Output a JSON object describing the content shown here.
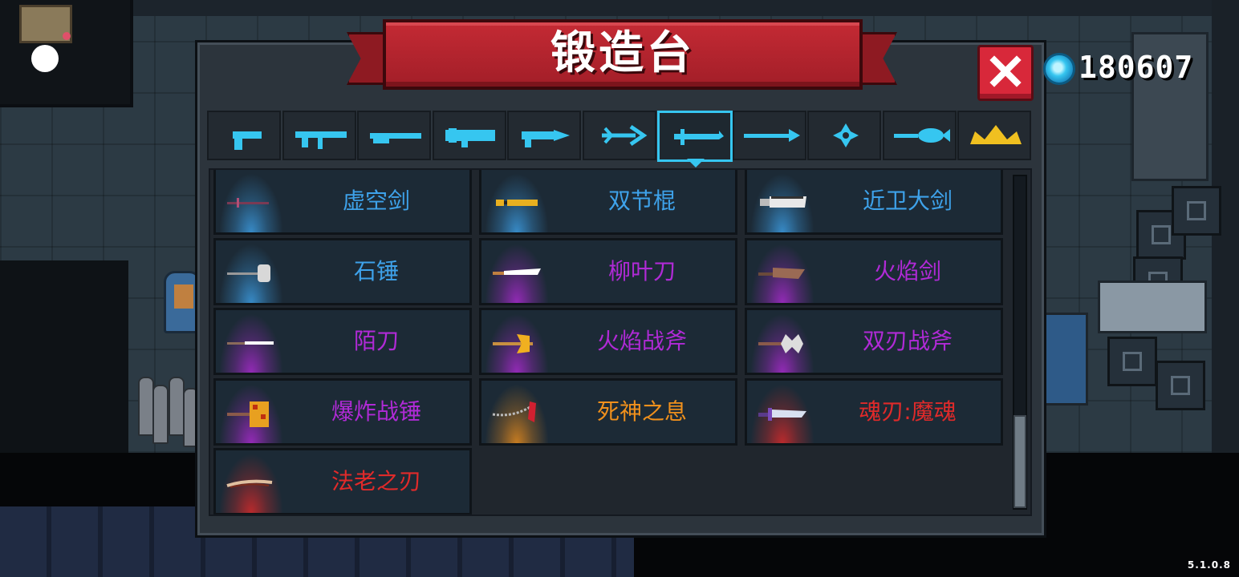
{
  "title": "锻造台",
  "gem_count": "180607",
  "version": "5.1.0.8",
  "colors": {
    "blue": "#3ea2ea",
    "purple": "#b02ad6",
    "orange": "#f0901c",
    "red": "#e02a2a",
    "accent": "#36c6f0"
  },
  "tabs": [
    {
      "icon": "pistol-icon",
      "selected": false
    },
    {
      "icon": "rifle-icon",
      "selected": false
    },
    {
      "icon": "shotgun-icon",
      "selected": false
    },
    {
      "icon": "launcher-icon",
      "selected": false
    },
    {
      "icon": "laser-gun-icon",
      "selected": false
    },
    {
      "icon": "bow-icon",
      "selected": false
    },
    {
      "icon": "sword-icon",
      "selected": true
    },
    {
      "icon": "spear-icon",
      "selected": false
    },
    {
      "icon": "shuriken-icon",
      "selected": false
    },
    {
      "icon": "fish-staff-icon",
      "selected": false
    },
    {
      "icon": "crown-icon",
      "selected": false
    }
  ],
  "weapons": [
    {
      "name": "虚空剑",
      "rarity": "blue",
      "icon": "void-sword-icon"
    },
    {
      "name": "双节棍",
      "rarity": "blue",
      "icon": "nunchaku-icon"
    },
    {
      "name": "近卫大剑",
      "rarity": "blue",
      "icon": "guard-greatsword-icon"
    },
    {
      "name": "石锤",
      "rarity": "blue",
      "icon": "stone-hammer-icon"
    },
    {
      "name": "柳叶刀",
      "rarity": "purple",
      "icon": "willow-blade-icon"
    },
    {
      "name": "火焰剑",
      "rarity": "purple",
      "icon": "flame-sword-icon"
    },
    {
      "name": "陌刀",
      "rarity": "purple",
      "icon": "mo-dao-icon"
    },
    {
      "name": "火焰战斧",
      "rarity": "purple",
      "icon": "flame-axe-icon"
    },
    {
      "name": "双刃战斧",
      "rarity": "purple",
      "icon": "double-axe-icon"
    },
    {
      "name": "爆炸战锤",
      "rarity": "purple",
      "icon": "explosive-hammer-icon"
    },
    {
      "name": "死神之息",
      "rarity": "orange",
      "icon": "death-scythe-icon"
    },
    {
      "name": "魂刃:魔魂",
      "rarity": "red",
      "icon": "soul-blade-icon"
    },
    {
      "name": "法老之刃",
      "rarity": "red",
      "icon": "pharaoh-blade-icon"
    }
  ],
  "scroll_position": 1.0
}
